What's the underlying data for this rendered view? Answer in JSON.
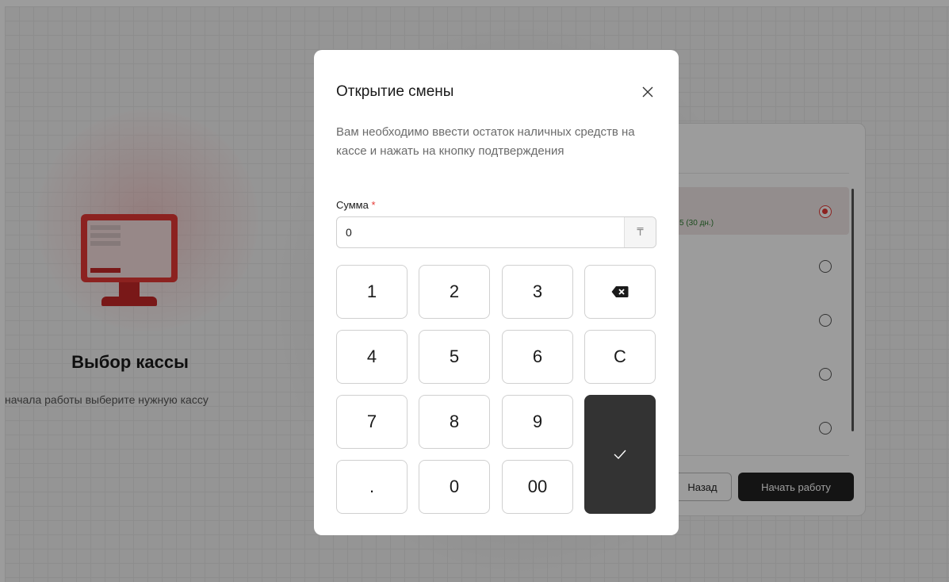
{
  "background": {
    "title": "Выбор кассы",
    "subtitle": "начала работы выберите нужную кассу",
    "selected_row_text": "5 (30 дн.)",
    "back_label": "Назад",
    "start_label": "Начать работу"
  },
  "modal": {
    "title": "Открытие смены",
    "description": "Вам необходимо ввести остаток наличных средств на кассе и нажать на кнопку подтверждения",
    "sum_label": "Сумма",
    "required_mark": "*",
    "sum_value": "0",
    "currency_symbol": "₸",
    "close_icon": "close-icon"
  },
  "keypad": {
    "k1": "1",
    "k2": "2",
    "k3": "3",
    "backspace_icon": "backspace-icon",
    "k4": "4",
    "k5": "5",
    "k6": "6",
    "clear": "C",
    "k7": "7",
    "k8": "8",
    "k9": "9",
    "confirm_icon": "check-icon",
    "dot": ".",
    "k0": "0",
    "k00": "00"
  },
  "colors": {
    "accent": "#e53935",
    "confirm_bg": "#333333",
    "overlay": "rgba(0,0,0,0.39)"
  }
}
